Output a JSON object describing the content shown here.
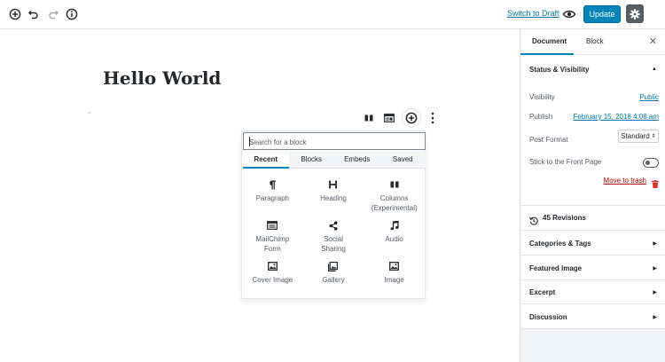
{
  "topbar": {
    "icons": [
      "add-block-icon",
      "undo-icon",
      "redo-icon",
      "info-icon"
    ],
    "switch_to_draft": "Switch to Draft",
    "preview_icon": "eye-icon",
    "update_label": "Update",
    "settings_icon": "gear-icon"
  },
  "editor": {
    "title": "Hello World"
  },
  "block_toolbar": {
    "icons": [
      "columns-icon",
      "layout-icon",
      "inserter-plus-icon",
      "more-vertical-icon"
    ]
  },
  "inserter": {
    "search_placeholder": "Search for a block",
    "tabs": [
      {
        "label": "Recent",
        "active": true
      },
      {
        "label": "Blocks",
        "active": false
      },
      {
        "label": "Embeds",
        "active": false
      },
      {
        "label": "Saved",
        "active": false
      }
    ],
    "items": [
      {
        "label": "Paragraph",
        "icon": "paragraph-icon"
      },
      {
        "label": "Heading",
        "icon": "heading-icon"
      },
      {
        "label": "Columns\n(Experimental)",
        "icon": "columns-icon"
      },
      {
        "label": "MailChimp\nForm",
        "icon": "form-icon"
      },
      {
        "label": "Social\nSharing",
        "icon": "share-icon"
      },
      {
        "label": "Audio",
        "icon": "music-note-icon"
      },
      {
        "label": "Cover Image",
        "icon": "image-icon"
      },
      {
        "label": "Gallery",
        "icon": "gallery-icon"
      },
      {
        "label": "Image",
        "icon": "image-icon"
      }
    ]
  },
  "sidebar": {
    "tabs": [
      {
        "label": "Document",
        "active": true
      },
      {
        "label": "Block",
        "active": false
      }
    ],
    "close_icon": "close-icon",
    "status_visibility": {
      "heading": "Status & Visibility",
      "visibility_label": "Visibility",
      "visibility_value": "Public",
      "publish_label": "Publish",
      "publish_value": "February 15, 2018 4:08 am",
      "post_format_label": "Post Format",
      "post_format_value": "Standard",
      "sticky_label": "Stick to the Front Page",
      "sticky_on": false,
      "trash_label": "Move to trash"
    },
    "revisions": "45 Revisions",
    "panels": [
      {
        "label": "Categories & Tags"
      },
      {
        "label": "Featured Image"
      },
      {
        "label": "Excerpt"
      },
      {
        "label": "Discussion"
      }
    ]
  },
  "colors": {
    "accent": "#0085ba",
    "link": "#0073aa",
    "danger": "#a00",
    "sidebar_bg": "#f3f4f5"
  }
}
